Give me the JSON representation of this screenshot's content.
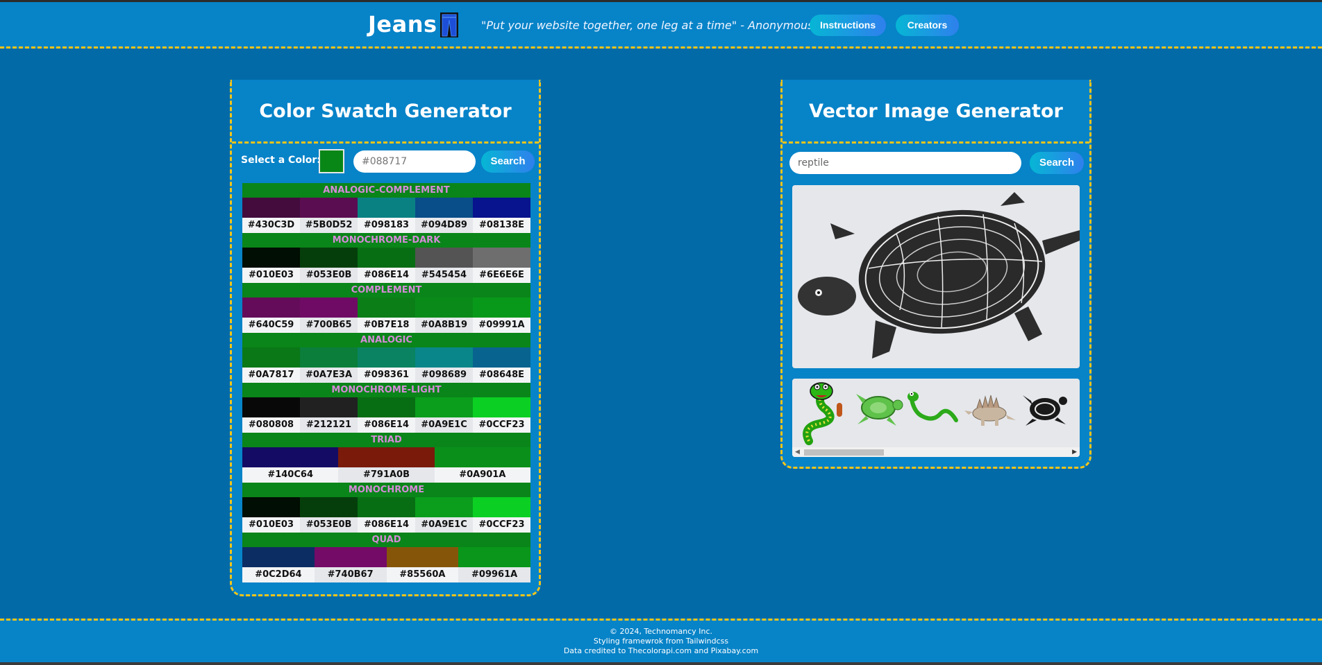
{
  "header": {
    "brand": "Jeans",
    "quote": "\"Put your website together, one leg at a time\" - Anonymous",
    "nav": {
      "instructions": "Instructions",
      "creators": "Creators"
    }
  },
  "color_panel": {
    "title": "Color Swatch Generator",
    "select_label": "Select a Color:",
    "selected_color": "#088717",
    "input_placeholder": "#088717",
    "search_label": "Search",
    "schemes": [
      {
        "name": "ANALOGIC-COMPLEMENT",
        "colors": [
          "#430C3D",
          "#5B0D52",
          "#098183",
          "#094D89",
          "#08138E"
        ]
      },
      {
        "name": "MONOCHROME-DARK",
        "colors": [
          "#010E03",
          "#053E0B",
          "#086E14",
          "#545454",
          "#6E6E6E"
        ]
      },
      {
        "name": "COMPLEMENT",
        "colors": [
          "#640C59",
          "#700B65",
          "#0B7E18",
          "#0A8B19",
          "#09991A"
        ]
      },
      {
        "name": "ANALOGIC",
        "colors": [
          "#0A7817",
          "#0A7E3A",
          "#098361",
          "#098689",
          "#08648E"
        ]
      },
      {
        "name": "MONOCHROME-LIGHT",
        "colors": [
          "#080808",
          "#212121",
          "#086E14",
          "#0A9E1C",
          "#0CCF23"
        ]
      },
      {
        "name": "TRIAD",
        "colors": [
          "#140C64",
          "#791A0B",
          "#0A901A"
        ]
      },
      {
        "name": "MONOCHROME",
        "colors": [
          "#010E03",
          "#053E0B",
          "#086E14",
          "#0A9E1C",
          "#0CCF23"
        ]
      },
      {
        "name": "QUAD",
        "colors": [
          "#0C2D64",
          "#740B67",
          "#85560A",
          "#09961A"
        ]
      }
    ]
  },
  "vector_panel": {
    "title": "Vector Image Generator",
    "input_value": "reptile",
    "search_label": "Search",
    "thumbnails": [
      "snake-cartoon",
      "sea-turtle",
      "green-snake",
      "stegosaurus",
      "tribal-turtle"
    ]
  },
  "footer": {
    "line1": "© 2024, Technomancy Inc.",
    "line2": "Styling framewrok from Tailwindcss",
    "line3": "Data credited to Thecolorapi.com and Pixabay.com"
  }
}
